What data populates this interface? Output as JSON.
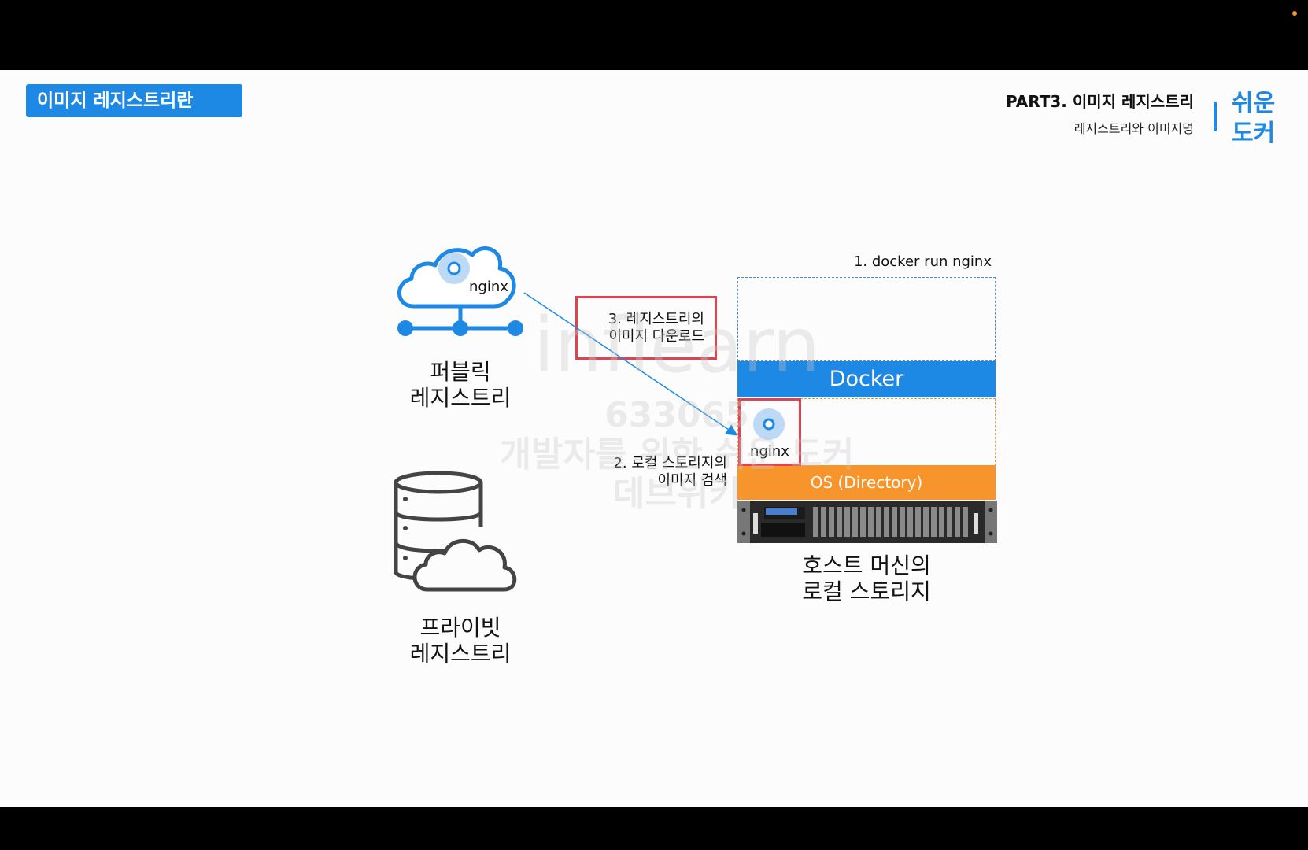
{
  "header": {
    "badge": "이미지 레지스트리란",
    "part_title": "PART3. 이미지 레지스트리",
    "part_subtitle": "레지스트리와 이미지명",
    "logo_line1": "쉬운",
    "logo_line2": "도커"
  },
  "public_registry": {
    "image_label": "nginx",
    "label_line1": "퍼블릭",
    "label_line2": "레지스트리"
  },
  "private_registry": {
    "label_line1": "프라이빗",
    "label_line2": "레지스트리"
  },
  "host": {
    "command": "1. docker run nginx",
    "docker_label": "Docker",
    "os_label": "OS (Directory)",
    "local_image_label": "nginx",
    "label_line1": "호스트 머신의",
    "label_line2": "로컬 스토리지"
  },
  "steps": {
    "step2_line1": "2. 로컬 스토리지의",
    "step2_line2": "이미지 검색",
    "step3_line1": "3. 레지스트리의",
    "step3_line2": "이미지 다운로드"
  },
  "watermark": {
    "brand": "inflearn",
    "id": "633065",
    "line1": "개발자를 위한 쉬운 도커",
    "line2": "데브위키"
  },
  "colors": {
    "accent_blue": "#1e88e5",
    "orange": "#f7942c",
    "highlight_red": "#e0434f"
  }
}
